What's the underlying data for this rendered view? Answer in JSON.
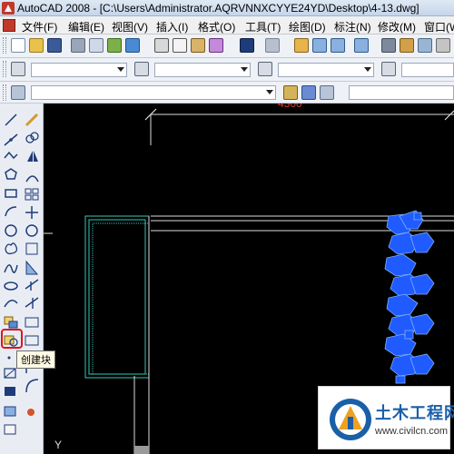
{
  "window": {
    "title": "AutoCAD 2008 - [C:\\Users\\Administrator.AQRVNNXCYYE24YD\\Desktop\\4-13.dwg]"
  },
  "menu": {
    "items": [
      {
        "label": "文件(F)"
      },
      {
        "label": "编辑(E)"
      },
      {
        "label": "视图(V)"
      },
      {
        "label": "插入(I)"
      },
      {
        "label": "格式(O)"
      },
      {
        "label": "工具(T)"
      },
      {
        "label": "绘图(D)"
      },
      {
        "label": "标注(N)"
      },
      {
        "label": "修改(M)"
      },
      {
        "label": "窗口(W)"
      }
    ]
  },
  "toolbars": {
    "standard_icons": [
      "new-icon",
      "open-icon",
      "save-icon",
      "print-icon",
      "print-preview-icon",
      "publish-icon",
      "cut-icon",
      "copy-icon",
      "paste-icon",
      "match-properties-icon",
      "undo-icon",
      "redo-icon",
      "pan-icon",
      "zoom-realtime-icon",
      "zoom-window-icon",
      "zoom-previous-icon",
      "properties-icon",
      "design-center-icon"
    ],
    "style_combo_value": "",
    "dim_style_combo_value": "",
    "table_style_combo_value": "",
    "layer_combo_value": ""
  },
  "draw_toolbar": {
    "icons": [
      "line-icon",
      "construction-line-icon",
      "polyline-icon",
      "polygon-icon",
      "rectangle-icon",
      "arc-icon",
      "circle-icon",
      "revision-cloud-icon",
      "spline-icon",
      "ellipse-icon",
      "ellipse-arc-icon",
      "insert-block-icon",
      "make-block-icon",
      "point-icon",
      "hatch-icon",
      "gradient-icon",
      "region-icon",
      "table-icon",
      "multiline-text-icon"
    ]
  },
  "modify_toolbar": {
    "icons": [
      "erase-icon",
      "copy-object-icon",
      "mirror-icon",
      "offset-icon",
      "array-icon",
      "move-icon",
      "rotate-icon",
      "scale-icon",
      "stretch-icon",
      "trim-icon",
      "extend-icon",
      "break-icon",
      "join-icon",
      "chamfer-icon",
      "fillet-icon",
      "explode-icon"
    ]
  },
  "tooltip": {
    "label": "创建块"
  },
  "drawing": {
    "dimension_text": "4300",
    "ucs_label": "Y",
    "line_color": "#dcdcdc",
    "frame_color": "#36c9b8",
    "plant_color": "#1f5bff",
    "gray_block_color": "#9a9a9a"
  },
  "watermark": {
    "name": "土木工程网",
    "url": "www.civilcn.com"
  },
  "colors": {
    "canvas_bg": "#000000",
    "highlight_border": "#e0141b",
    "title_bar": "#c5d5ea"
  }
}
